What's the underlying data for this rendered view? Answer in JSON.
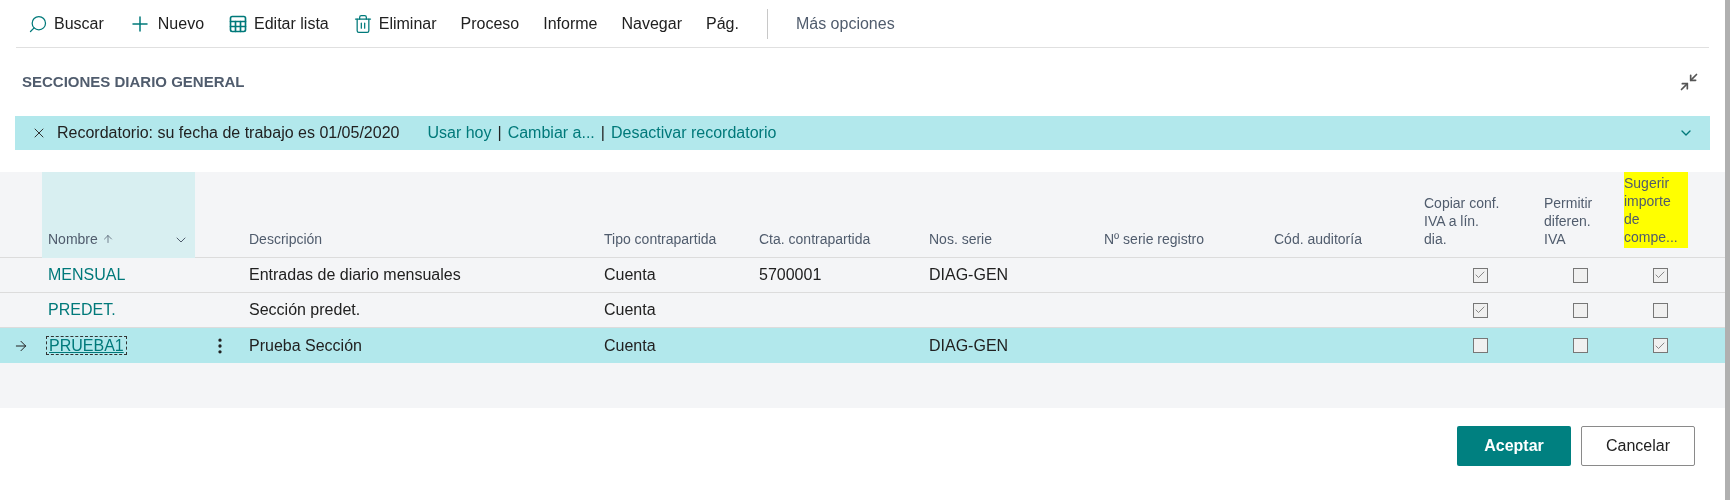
{
  "toolbar": [
    {
      "label": "Buscar",
      "kind": "search"
    },
    {
      "label": "Nuevo",
      "kind": "new"
    },
    {
      "label": "Editar lista",
      "kind": "edit-list"
    },
    {
      "label": "Eliminar",
      "kind": "delete"
    },
    {
      "label": "Proceso",
      "kind": "menu"
    },
    {
      "label": "Informe",
      "kind": "menu"
    },
    {
      "label": "Navegar",
      "kind": "menu"
    },
    {
      "label": "Pág.",
      "kind": "menu"
    },
    {
      "label": "Más opciones",
      "kind": "more"
    }
  ],
  "title": "SECCIONES DIARIO GENERAL",
  "banner": {
    "message": "Recordatorio: su fecha de trabajo es 01/05/2020",
    "links": [
      "Usar hoy",
      "Cambiar a...",
      "Desactivar recordatorio"
    ],
    "separator": "|",
    "expanded": false
  },
  "table": {
    "columns": [
      {
        "label": "Nombre",
        "sorted_ascending": true,
        "highlighted": false
      },
      {
        "label": "Descripción",
        "highlighted": false
      },
      {
        "label": "Tipo contrapartida",
        "highlighted": false
      },
      {
        "label": "Cta. contrapartida",
        "highlighted": false
      },
      {
        "label": "Nos. serie",
        "highlighted": false
      },
      {
        "label": "Nº serie registro",
        "highlighted": false
      },
      {
        "label": "Cód. auditoría",
        "highlighted": false
      },
      {
        "label": "Copiar conf. IVA a lín. dia.",
        "highlighted": false
      },
      {
        "label": "Permitir diferen. IVA",
        "highlighted": false
      },
      {
        "label": "Sugerir importe de compe...",
        "highlighted": true
      }
    ],
    "rows": [
      {
        "name": "MENSUAL",
        "description": "Entradas de diario mensuales",
        "type": "Cuenta",
        "account": "5700001",
        "series": "DIAG-GEN",
        "copy_vat": true,
        "allow_vat_diff": false,
        "suggest_balance": true,
        "selected": false
      },
      {
        "name": "PREDET.",
        "description": "Sección predet.",
        "type": "Cuenta",
        "copy_vat": true,
        "allow_vat_diff": false,
        "suggest_balance": false,
        "selected": false
      },
      {
        "name": "PRUEBA1",
        "description": "Prueba Sección",
        "type": "Cuenta",
        "series": "DIAG-GEN",
        "copy_vat": false,
        "allow_vat_diff": false,
        "suggest_balance": true,
        "selected": true
      }
    ]
  },
  "buttons": [
    {
      "label": "Aceptar",
      "kind": "primary"
    },
    {
      "label": "Cancelar",
      "kind": "secondary"
    }
  ]
}
